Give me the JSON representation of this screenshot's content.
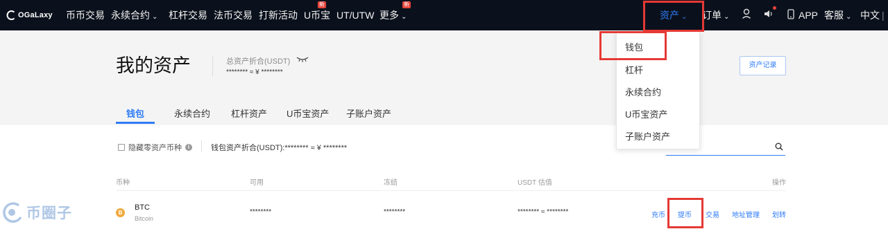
{
  "logo": {
    "text": "OGaLaxy"
  },
  "nav": {
    "items": [
      {
        "label": "币币交易"
      },
      {
        "label": "永续合约"
      },
      {
        "label": "杠杆交易"
      },
      {
        "label": "法币交易"
      },
      {
        "label": "打新活动"
      },
      {
        "label": "U币宝",
        "badge": "新"
      },
      {
        "label": "UT/UTW"
      },
      {
        "label": "更多",
        "badge": "新"
      }
    ],
    "assets": "资产",
    "orders": "订单",
    "app": "APP",
    "service": "客服",
    "language": "中文",
    "separator": "|"
  },
  "header": {
    "title": "我的资产",
    "total_label": "总资产折合(USDT)",
    "total_value": "******** ≈ ¥ ********",
    "record_button": "资产记录"
  },
  "tabs": [
    {
      "label": "钱包",
      "active": true
    },
    {
      "label": "永续合约"
    },
    {
      "label": "杠杆资产"
    },
    {
      "label": "U币宝资产"
    },
    {
      "label": "子账户资产"
    }
  ],
  "filter": {
    "hide_zero": "隐藏零资产币种",
    "info": "i",
    "wallet_sum": "钱包资产折合(USDT):******** ≈ ¥ ********"
  },
  "table": {
    "headers": [
      "币种",
      "可用",
      "冻结",
      "USDT 估值",
      "操作"
    ],
    "rows": [
      {
        "icon": "B",
        "symbol": "BTC",
        "name": "Bitcoin",
        "available": "********",
        "frozen": "********",
        "usdt_value": "******** ≈ ********",
        "actions": [
          "充币",
          "提币",
          "交易",
          "地址管理",
          "划转"
        ]
      }
    ]
  },
  "dropdown": {
    "items": [
      "钱包",
      "杠杆",
      "永续合约",
      "U币宝资产",
      "子账户资产"
    ]
  },
  "watermark": {
    "text": "币圈子"
  },
  "colors": {
    "accent": "#2f7cf6",
    "nav_bg": "#0b111c",
    "highlight": "#e53935",
    "badge": "#e5433a"
  }
}
